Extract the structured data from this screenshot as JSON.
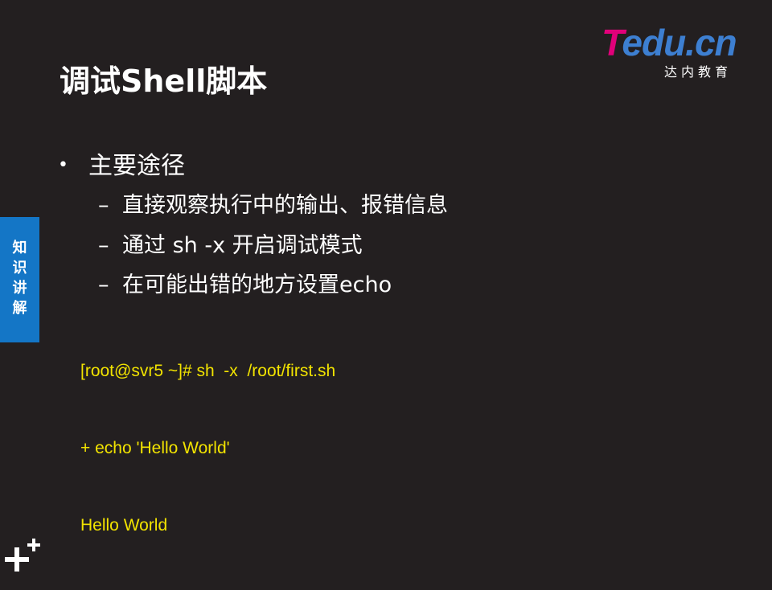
{
  "slide": {
    "title": "调试Shell脚本",
    "logo": {
      "brand_t": "T",
      "brand_rest": "edu.cn",
      "subtitle": "达内教育"
    },
    "side_tab": {
      "label": "知\n识\n讲\n解"
    },
    "bullet": {
      "marker": "•",
      "text": "主要途径"
    },
    "sub_items": [
      {
        "marker": "–",
        "text": "直接观察执行中的输出、报错信息"
      },
      {
        "marker": "–",
        "text": "通过 sh  -x 开启调试模式"
      },
      {
        "marker": "–",
        "text": "在可能出错的地方设置echo"
      }
    ],
    "code_lines": [
      "[root@svr5 ~]# sh  -x  /root/first.sh",
      "+ echo 'Hello World'",
      "Hello World"
    ]
  },
  "colors": {
    "background": "#231f20",
    "accent_blue": "#1476c6",
    "code_yellow": "#f2e300",
    "logo_pink": "#e2007a",
    "logo_blue": "#3d7fd1"
  }
}
